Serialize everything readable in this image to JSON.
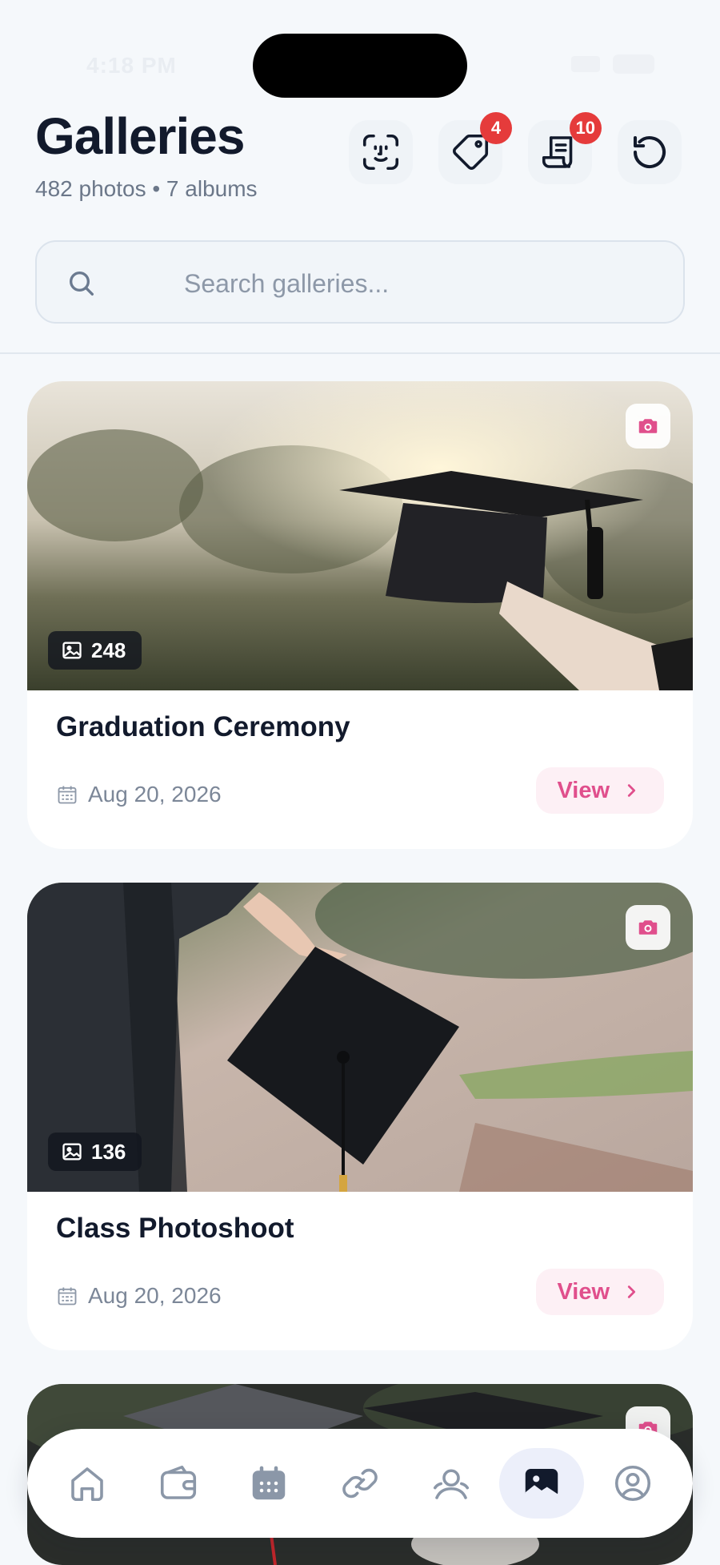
{
  "status": {
    "time": "4:18 PM"
  },
  "header": {
    "title": "Galleries",
    "subtitle": "482 photos • 7 albums",
    "actions": [
      {
        "icon": "face-scan-icon",
        "badge": ""
      },
      {
        "icon": "tag-icon",
        "badge": "4"
      },
      {
        "icon": "receipt-icon",
        "badge": "10"
      },
      {
        "icon": "refresh-icon",
        "badge": ""
      }
    ]
  },
  "search": {
    "placeholder": "Search galleries...",
    "value": ""
  },
  "galleries": [
    {
      "title": "Graduation Ceremony",
      "date": "Aug 20, 2026",
      "count": "248",
      "view_label": "View"
    },
    {
      "title": "Class Photoshoot",
      "date": "Aug 20, 2026",
      "count": "136",
      "view_label": "View"
    },
    {
      "title": "",
      "date": "",
      "count": "",
      "view_label": ""
    }
  ],
  "nav": {
    "items": [
      "home-icon",
      "wallet-icon",
      "calendar-icon",
      "link-icon",
      "users-icon",
      "gallery-icon",
      "profile-icon"
    ],
    "active": "gallery-icon"
  },
  "colors": {
    "accent": "#e04f8c",
    "badge": "#e53b3b",
    "title": "#121a2c",
    "muted": "#7c8798",
    "background": "#f5f8fb"
  }
}
